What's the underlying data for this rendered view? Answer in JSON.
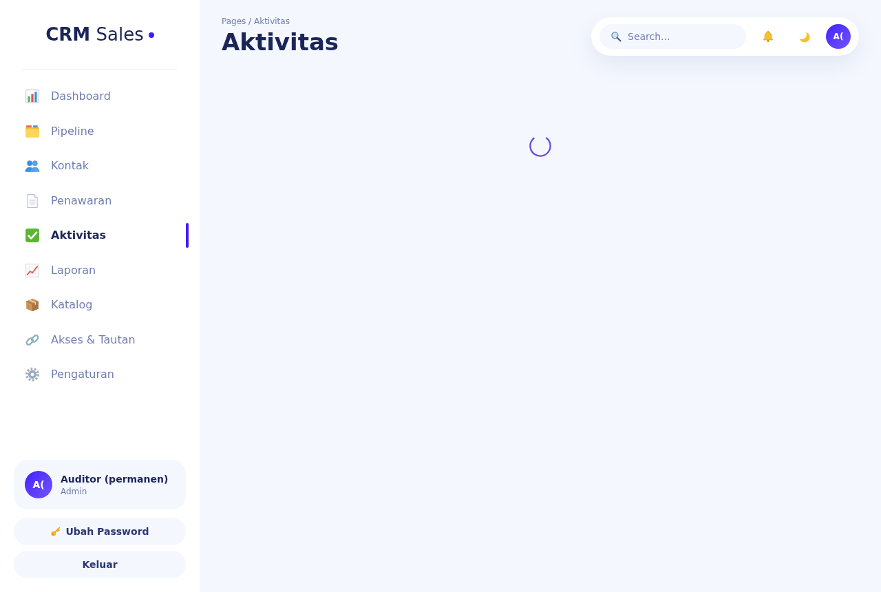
{
  "brand": "**CRM** Sales",
  "nav": [
    {
      "label": "Dashboard",
      "selected": false
    },
    {
      "label": "Pipeline",
      "selected": false
    },
    {
      "label": "Kontak",
      "selected": false
    },
    {
      "label": "Penawaran",
      "selected": false
    },
    {
      "label": "Aktivitas",
      "selected": true
    },
    {
      "label": "Laporan",
      "selected": false
    },
    {
      "label": "Katalog",
      "selected": false
    },
    {
      "label": "Akses & Tautan",
      "selected": false
    },
    {
      "label": "Pengaturan",
      "selected": false
    }
  ],
  "user": {
    "initials": "A(",
    "name": "Auditor (permanen)",
    "role": "Admin"
  },
  "sidebar_buttons": [
    {
      "label": "Ubah Password"
    },
    {
      "label": "Keluar"
    }
  ],
  "breadcrumb": "Pages / Aktivitas",
  "page_title": "Aktivitas",
  "search": {
    "placeholder": "Search..."
  },
  "header_avatar": {
    "initials": "A("
  },
  "loading": true
}
